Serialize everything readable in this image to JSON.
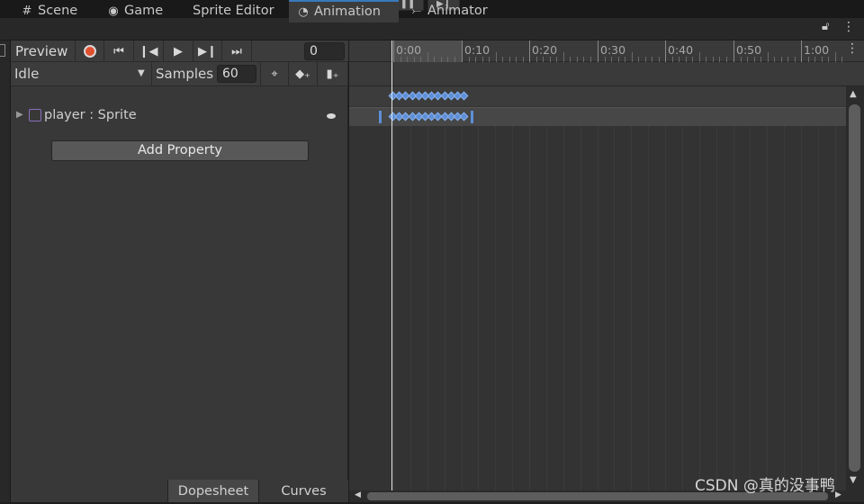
{
  "tabs": [
    {
      "label": "Scene",
      "icon": "grid-icon"
    },
    {
      "label": "Game",
      "icon": "gamepad-icon"
    },
    {
      "label": "Sprite Editor",
      "icon": ""
    },
    {
      "label": "Animation",
      "icon": "clock-icon"
    },
    {
      "label": "Animator",
      "icon": "animator-icon"
    }
  ],
  "toolbar": {
    "preview_label": "Preview",
    "frame_value": "0"
  },
  "clip": {
    "selected": "Idle",
    "samples_label": "Samples",
    "samples_value": "60"
  },
  "properties": [
    {
      "label": "player : Sprite"
    }
  ],
  "add_property_label": "Add Property",
  "ruler": {
    "labels": [
      "0:00",
      "0:10",
      "0:20",
      "0:30",
      "0:40",
      "0:50",
      "1:00"
    ]
  },
  "bottom_tabs": [
    "Dopesheet",
    "Curves"
  ],
  "watermark": "CSDN @真的没事鸭",
  "colors": {
    "accent": "#3a79bb",
    "record": "#e0502f",
    "keyframe": "#5e8fd6"
  }
}
